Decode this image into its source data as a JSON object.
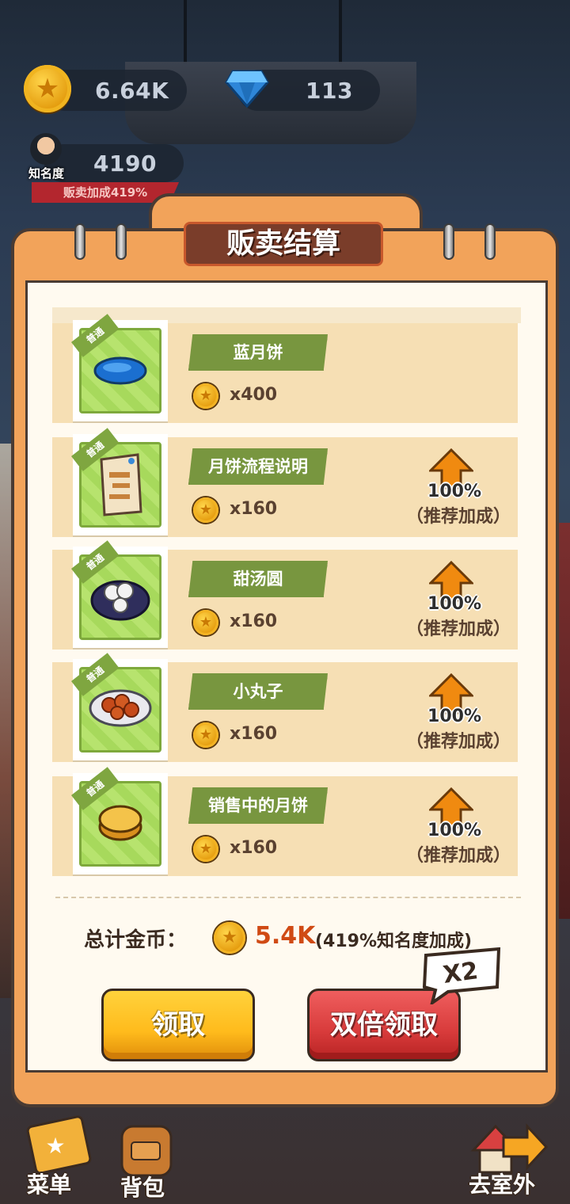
{
  "hud": {
    "coins": "6.64K",
    "gems": "113",
    "fame_value": "4190",
    "fame_label": "知名度",
    "sell_bonus": "贩卖加成419%"
  },
  "panel": {
    "title": "贩卖结算"
  },
  "items": [
    {
      "badge": "普通",
      "name": "蓝月饼",
      "price": "x400",
      "bonus_percent": "",
      "bonus_note": "",
      "icon": "blue-mooncake-icon"
    },
    {
      "badge": "普通",
      "name": "月饼流程说明",
      "price": "x160",
      "bonus_percent": "100%",
      "bonus_note": "（推荐加成）",
      "icon": "paper-scroll-icon"
    },
    {
      "badge": "普通",
      "name": "甜汤圆",
      "price": "x160",
      "bonus_percent": "100%",
      "bonus_note": "（推荐加成）",
      "icon": "rice-balls-icon"
    },
    {
      "badge": "普通",
      "name": "小丸子",
      "price": "x160",
      "bonus_percent": "100%",
      "bonus_note": "（推荐加成）",
      "icon": "meatballs-plate-icon"
    },
    {
      "badge": "普通",
      "name": "销售中的月饼",
      "price": "x160",
      "bonus_percent": "100%",
      "bonus_note": "（推荐加成）",
      "icon": "golden-mooncake-icon"
    }
  ],
  "total": {
    "label": "总计金币：",
    "value": "5.4K",
    "note": "(419%知名度加成)"
  },
  "buttons": {
    "claim": "领取",
    "double_claim": "双倍领取",
    "x2_badge": "X2"
  },
  "nav": {
    "menu": "菜单",
    "backpack": "背包",
    "outdoor": "去室外"
  },
  "colors": {
    "panel_orange": "#f2a35a",
    "claim_yellow": "#ffbb1c",
    "double_red": "#d83b3b",
    "name_plate_green": "#78963f",
    "total_value_red": "#d04a14"
  }
}
